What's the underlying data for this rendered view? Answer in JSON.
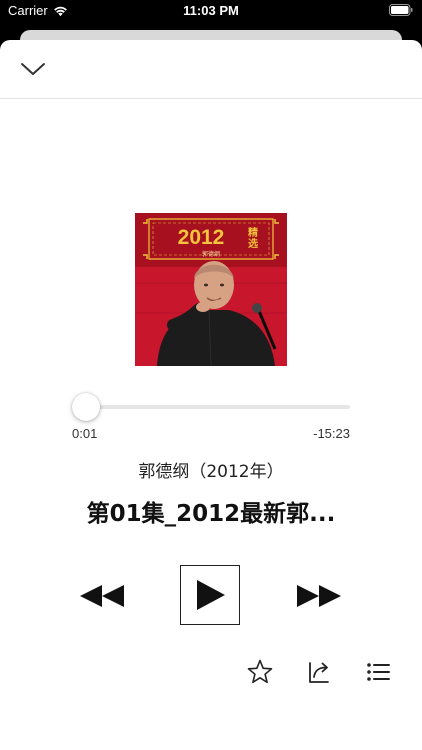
{
  "status_bar": {
    "carrier": "Carrier",
    "time": "11:03 PM"
  },
  "header": {
    "dismiss_icon": "chevron-down-icon"
  },
  "artwork": {
    "banner_number": "2012",
    "banner_tag": "精选",
    "banner_name": "郭德纲",
    "colors": {
      "background": "#c8162c",
      "banner": "#a6101f",
      "gold": "#f2c43c"
    }
  },
  "player": {
    "progress": 0.0011,
    "elapsed": "0:01",
    "remaining": "-15:23",
    "album": "郭德纲（2012年）",
    "track": "第01集_2012最新郭..."
  },
  "controls": {
    "rewind_icon": "rewind-icon",
    "play_icon": "play-icon",
    "forward_icon": "fast-forward-icon"
  },
  "actions": {
    "favorite_icon": "star-icon",
    "share_icon": "share-icon",
    "playlist_icon": "list-icon"
  }
}
